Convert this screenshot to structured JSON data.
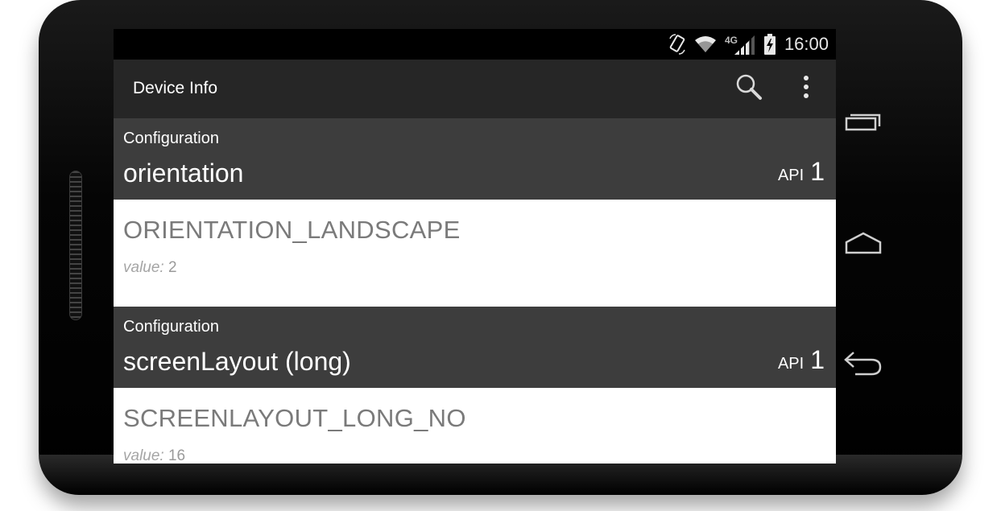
{
  "status_bar": {
    "time": "16:00",
    "network_label": "4G",
    "icons": [
      "rotate-icon",
      "wifi-icon",
      "lte-icon",
      "signal-icon",
      "battery-charging-icon"
    ]
  },
  "action_bar": {
    "title": "Device Info",
    "icons": [
      "search-icon",
      "overflow-menu-icon"
    ]
  },
  "sections": [
    {
      "category": "Configuration",
      "name": "orientation",
      "api_label": "API",
      "api_level": "1",
      "constant": "ORIENTATION_LANDSCAPE",
      "value_label": "value:",
      "value": "2"
    },
    {
      "category": "Configuration",
      "name": "screenLayout (long)",
      "api_label": "API",
      "api_level": "1",
      "constant": "SCREENLAYOUT_LONG_NO",
      "value_label": "value:",
      "value": "16"
    }
  ],
  "nav_buttons": [
    "recent-apps-icon",
    "home-icon",
    "back-icon"
  ],
  "colors": {
    "action_bar": "#262626",
    "section_header": "#3d3d3d",
    "body_bg": "#ffffff",
    "constant_text": "#7a7a7a"
  }
}
